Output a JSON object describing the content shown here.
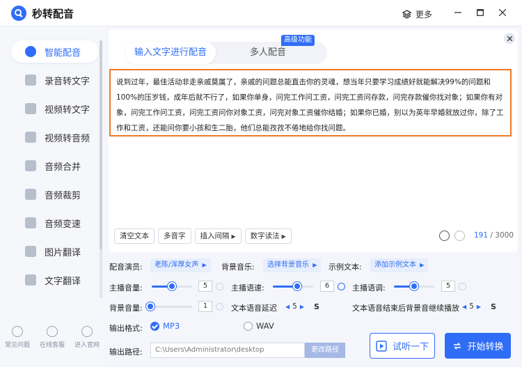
{
  "app": {
    "title": "秒转配音",
    "more_label": "更多"
  },
  "sidebar": {
    "items": [
      {
        "label": "智能配音"
      },
      {
        "label": "录音转文字"
      },
      {
        "label": "视频转文字"
      },
      {
        "label": "视频转音频"
      },
      {
        "label": "音频合并"
      },
      {
        "label": "音频裁剪"
      },
      {
        "label": "音频变速"
      },
      {
        "label": "图片翻译"
      },
      {
        "label": "文字翻译"
      }
    ],
    "bottom": [
      {
        "label": "常见问题"
      },
      {
        "label": "在线客服"
      },
      {
        "label": "进入官网"
      }
    ]
  },
  "tabs": {
    "active": "输入文字进行配音",
    "other": "多人配音",
    "badge": "高级功能"
  },
  "editor": {
    "text": "说到过年，最佳活动非走亲戚莫属了，亲戚的问题总能直击你的灵魂，想当年只要学习成绩好就能解决99%的问题和100%的压岁钱，成年后就不行了，如果你单身，问完工作问工资，问完工资问存款，问完存款催你找对象；如果你有对象，问完工作问工资，问完工资问你对象工资，问完对象工资催你结婚；如果你已婚，别以为英年早婚就放过你，除了工作和工资，还能问你要小孩和生二胎，他们总能孜孜不倦地给你找问题。",
    "tools": [
      "清空文本",
      "多音字",
      "插入间隔",
      "数字读法"
    ],
    "count_current": "191",
    "count_sep": " / ",
    "count_max": "3000"
  },
  "settings": {
    "voice_label": "配音演员:",
    "voice_value": "老陈/浑厚女声",
    "bgm_label": "背景音乐:",
    "bgm_value": "选择背景音乐",
    "sample_label": "示例文本:",
    "sample_value": "添加示例文本",
    "volume_label": "主播音量:",
    "volume_value": "5",
    "volume_fraction": 0.5,
    "speed_label": "主播语速:",
    "speed_value": "6",
    "speed_fraction": 0.6,
    "pitch_label": "主播语调:",
    "pitch_value": "5",
    "pitch_fraction": 0.5,
    "bg_volume_label": "背景音量:",
    "bg_volume_value": "1",
    "bg_volume_fraction": 0.0,
    "delay_label": "文本语音延迟",
    "delay_value": "5",
    "delay_unit": "S",
    "continue_label": "文本语音结束后背景音继续播放",
    "continue_value": "5",
    "continue_unit": "S",
    "format_label": "输出格式:",
    "format_mp3": "MP3",
    "format_wav": "WAV",
    "path_label": "输出路径:",
    "path_value": "C:\\Users\\Administrator\\desktop",
    "path_button": "更改路径"
  },
  "actions": {
    "preview": "试听一下",
    "start": "开始转换"
  },
  "colors": {
    "accent": "#2f6df6",
    "highlight_border": "#ee7a26"
  }
}
